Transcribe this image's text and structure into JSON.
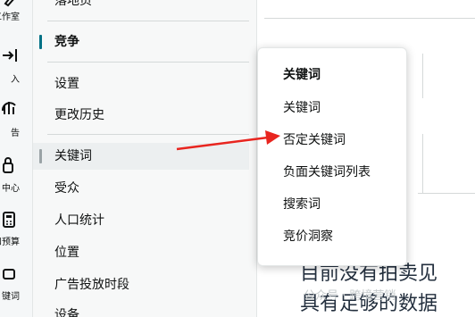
{
  "rail": {
    "items": [
      {
        "label": "工作室",
        "icon": "brush-icon"
      },
      {
        "label": "入",
        "icon": "import-arrow-icon"
      },
      {
        "label": "告",
        "icon": "report-icon"
      },
      {
        "label": "中心",
        "icon": "lock-icon"
      },
      {
        "label": "和预算",
        "icon": "calculator-icon"
      },
      {
        "label": "键词",
        "icon": "keyword-icon"
      }
    ]
  },
  "nav": {
    "cut_item": "落地页",
    "section_title": "竞争",
    "items": [
      "设置",
      "更改历史"
    ],
    "group_items": [
      "关键词",
      "受众",
      "人口统计",
      "位置",
      "广告投放时段",
      "设备"
    ]
  },
  "menu": {
    "header": "关键词",
    "items": [
      "关键词",
      "否定关键词",
      "负面关键词列表",
      "搜索词",
      "竞价洞察"
    ]
  },
  "main": {
    "empty_line_1": "目前没有拍卖见",
    "empty_line_2": "具有足够的数据"
  },
  "watermark": "公众号 · 跨境营销",
  "colors": {
    "accent": "#007185",
    "arrow": "#e8251f"
  }
}
